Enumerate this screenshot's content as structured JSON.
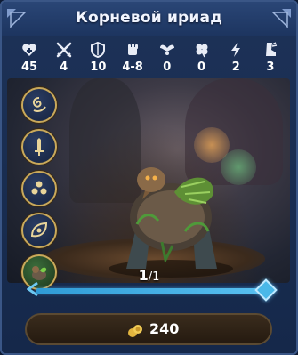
{
  "header": {
    "title": "Корневой ириад"
  },
  "stats": [
    {
      "icon": "heart-icon",
      "value": "45"
    },
    {
      "icon": "crossed-swords-icon",
      "value": "4"
    },
    {
      "icon": "shield-icon",
      "value": "10"
    },
    {
      "icon": "fist-damage-icon",
      "value": "4-8"
    },
    {
      "icon": "wings-icon",
      "value": "0"
    },
    {
      "icon": "clover-luck-icon",
      "value": "0"
    },
    {
      "icon": "lightning-icon",
      "value": "2"
    },
    {
      "icon": "boot-speed-icon",
      "value": "3"
    }
  ],
  "skills": [
    {
      "icon": "nature-swirl-icon"
    },
    {
      "icon": "sword-icon"
    },
    {
      "icon": "cluster-icon"
    },
    {
      "icon": "leaf-eye-icon"
    },
    {
      "icon": "creature-portrait-icon"
    }
  ],
  "pagination": {
    "current": "1",
    "total": "/1"
  },
  "cost": {
    "icon": "gold-coins-icon",
    "value": "240"
  },
  "colors": {
    "accent": "#4ab8e8",
    "panel": "#1d3258",
    "gold_border": "#c9a95b"
  }
}
